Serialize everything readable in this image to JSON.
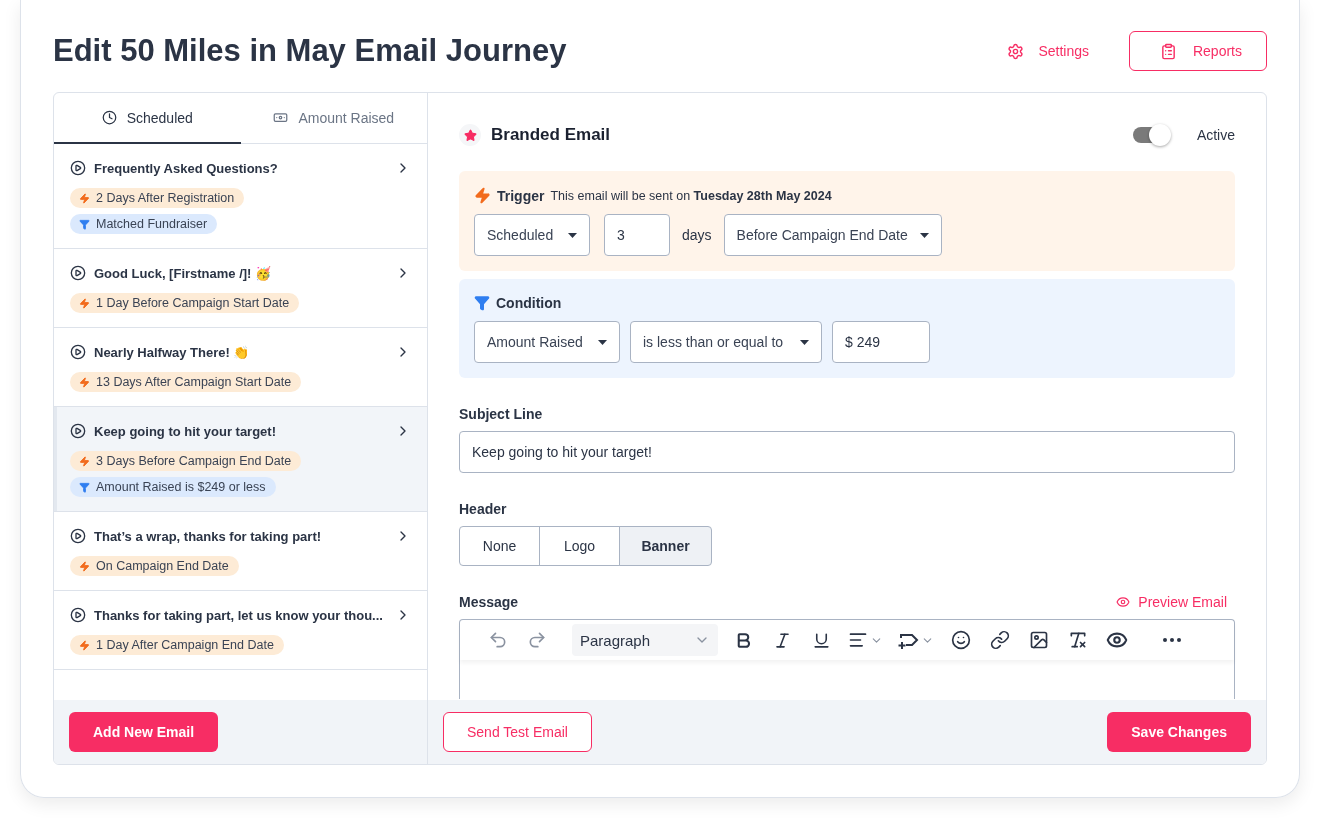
{
  "title": "Edit 50 Miles in May Email Journey",
  "header_actions": {
    "settings": "Settings",
    "reports": "Reports"
  },
  "tabs": [
    {
      "label": "Scheduled",
      "selected": true
    },
    {
      "label": "Amount Raised",
      "selected": false
    }
  ],
  "emails": [
    {
      "title": "Frequently Asked Questions?",
      "selected": false,
      "tags": [
        {
          "kind": "trigger",
          "label": "2 Days After Registration"
        },
        {
          "kind": "condition",
          "label": "Matched Fundraiser"
        }
      ]
    },
    {
      "title": "Good Luck, [Firstname /]! 🥳",
      "selected": false,
      "tags": [
        {
          "kind": "trigger",
          "label": "1 Day Before Campaign Start Date"
        }
      ]
    },
    {
      "title": "Nearly Halfway There! 👏",
      "selected": false,
      "tags": [
        {
          "kind": "trigger",
          "label": "13 Days After Campaign Start Date"
        }
      ]
    },
    {
      "title": "Keep going to hit your target!",
      "selected": true,
      "tags": [
        {
          "kind": "trigger",
          "label": "3 Days Before Campaign End Date"
        },
        {
          "kind": "condition",
          "label": "Amount Raised is $249 or less"
        }
      ]
    },
    {
      "title": "That’s a wrap, thanks for taking part!",
      "selected": false,
      "tags": [
        {
          "kind": "trigger",
          "label": "On Campaign End Date"
        }
      ]
    },
    {
      "title": "Thanks for taking part, let us know your thou...",
      "selected": false,
      "tags": [
        {
          "kind": "trigger",
          "label": "1 Day After Campaign End Date"
        }
      ]
    }
  ],
  "add_button": "Add New Email",
  "editor": {
    "heading": "Branded Email",
    "active": {
      "label": "Active",
      "on": true
    },
    "trigger": {
      "label": "Trigger",
      "sentence": "This email will be sent on **Tuesday 28th May 2024**",
      "type": "Scheduled",
      "amount": "3",
      "unit": "days",
      "reference": "Before Campaign End Date"
    },
    "condition": {
      "label": "Condition",
      "field": "Amount Raised",
      "operator": "is less than or equal to",
      "value": "$ 249"
    },
    "subject": {
      "label": "Subject Line",
      "value": "Keep going to hit your target!"
    },
    "header": {
      "label": "Header",
      "options": [
        {
          "label": "None",
          "selected": false
        },
        {
          "label": "Logo",
          "selected": false
        },
        {
          "label": "Banner",
          "selected": true
        }
      ]
    },
    "message": {
      "label": "Message",
      "preview": "Preview Email",
      "block_format": "Paragraph"
    }
  },
  "footer": {
    "test": "Send Test Email",
    "save": "Save Changes"
  }
}
